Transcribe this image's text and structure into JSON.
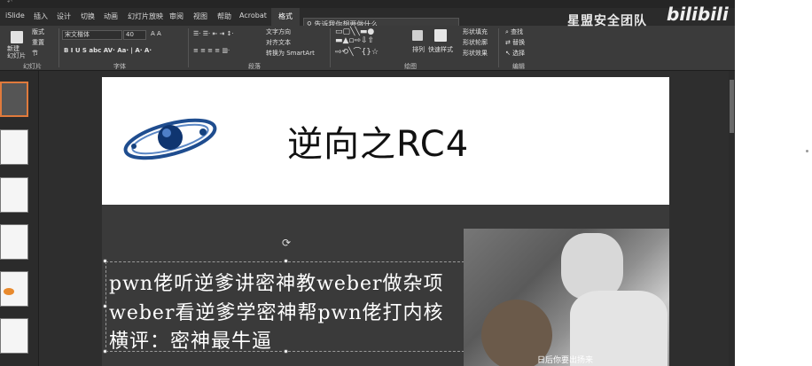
{
  "top_strip": {
    "left_text": "↶",
    "center_text": ""
  },
  "ribbon_tabs": [
    "iSlide",
    "插入",
    "设计",
    "切换",
    "动画",
    "幻灯片放映",
    "审阅",
    "视图",
    "帮助",
    "Acrobat",
    "格式"
  ],
  "search": {
    "placeholder": "告诉我你想要做什么"
  },
  "ribbon": {
    "slides": {
      "new_slide": "新建\n幻灯片",
      "layout": "版式",
      "reset": "重置",
      "section": "节",
      "label": "幻灯片"
    },
    "font": {
      "family": "宋文楷体",
      "size": "40",
      "label": "字体"
    },
    "paragraph": {
      "text_dir": "文字方向",
      "align_text": "对齐文本",
      "smartart": "转换为 SmartArt",
      "label": "段落"
    },
    "drawing": {
      "arrange": "排列",
      "quick_styles": "快速样式",
      "fill": "形状填充",
      "outline": "形状轮廓",
      "effects": "形状效果",
      "label": "绘图"
    },
    "editing": {
      "find": "查找",
      "replace": "替换",
      "select": "选择",
      "label": "编辑"
    }
  },
  "watermark": {
    "team": "星盟安全团队",
    "brand": "bilibili"
  },
  "slide": {
    "title": "逆向之RC4",
    "lines": [
      "pwn佬听逆爹讲密神教weber做杂项",
      "weber看逆爹学密神帮pwn佬打内核",
      "横评：密神最牛逼"
    ],
    "video_subtitle": "日后你要出扬来"
  },
  "colors": {
    "app_bg": "#2b2b2b",
    "ribbon_bg": "#3b3b3b",
    "selected_thumb": "#e07a3c"
  }
}
